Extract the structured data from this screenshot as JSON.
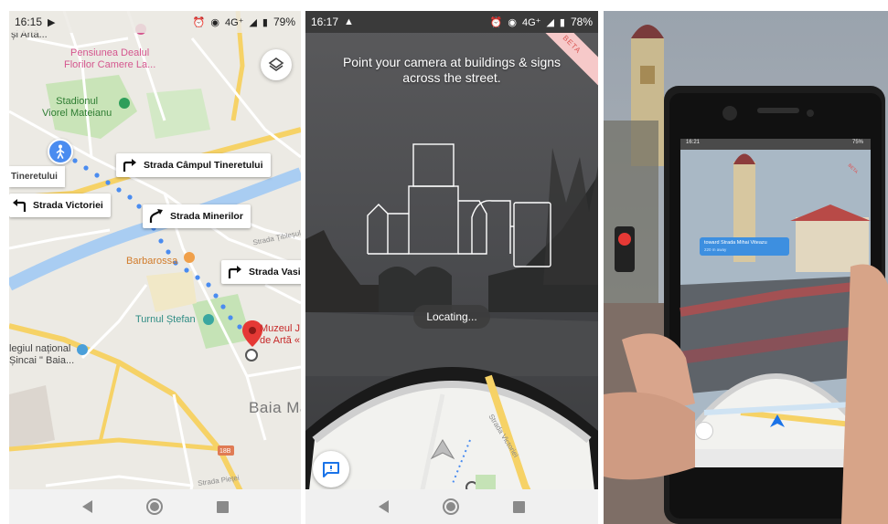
{
  "map_panel": {
    "status": {
      "time": "16:15",
      "signal": "4G⁺",
      "battery": "79%"
    },
    "labels": {
      "top_left": "și Artă...",
      "pensiunea": "Pensiunea Dealul\nFlorilor Camere La...",
      "stadion": "Stadionul\nViorel Mateianu",
      "tineretului": "Tineretului",
      "barbarossa": "Barbarossa",
      "turnul": "Turnul Ștefan",
      "colegiul": "legiul național\nȘincai \" Baia...",
      "muzeul": "Muzeul J\nde Artă «",
      "city": "Baia Ma",
      "street_tiblesului": "Strada Țibleșul",
      "street_pietei": "Strada Pieței",
      "road_number": "18B"
    },
    "directions": [
      {
        "label": "Strada Câmpul Tineretului",
        "arrow": "turn-right"
      },
      {
        "label": "Strada Victoriei",
        "arrow": "turn-left"
      },
      {
        "label": "Strada Minerilor",
        "arrow": "slight-right"
      },
      {
        "label": "Strada Vasil",
        "arrow": "turn-right"
      }
    ]
  },
  "liveview_panel": {
    "status": {
      "time": "16:17",
      "signal": "4G⁺",
      "battery": "78%"
    },
    "hint": "Point your camera at buildings & signs across the street.",
    "beta": "BETA",
    "locating": "Locating...",
    "street_label": "Strada Victoriei"
  },
  "photo_panel": {
    "phone_chip": "toward Strada Mihai Viteazu",
    "phone_chip_sub": "220 m away",
    "phone_status_time": "16:21",
    "phone_battery": "75%",
    "phone_beta": "BETA"
  },
  "colors": {
    "route": "#4a8cf0",
    "pin": "#e53935",
    "highway": "#f6d266",
    "river": "#a9cdf2",
    "park": "#c5e3b6"
  }
}
